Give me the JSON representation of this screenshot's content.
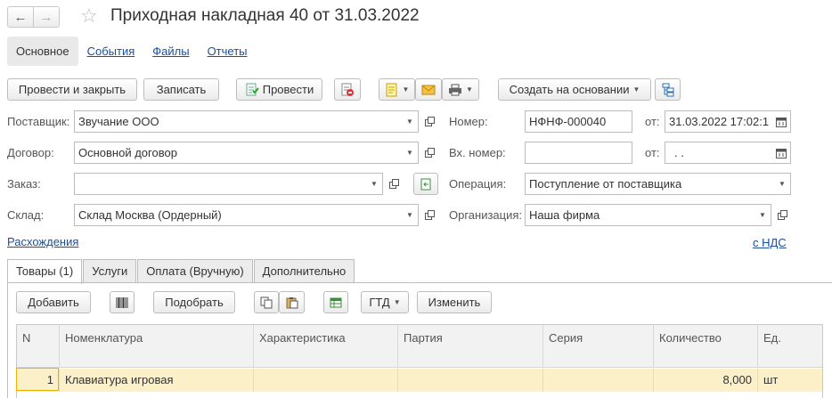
{
  "window": {
    "title": "Приходная накладная 40 от 31.03.2022"
  },
  "sections": [
    "Основное",
    "События",
    "Файлы",
    "Отчеты"
  ],
  "toolbar": {
    "post_close": "Провести и закрыть",
    "save": "Записать",
    "post": "Провести",
    "create_based": "Создать на основании"
  },
  "form": {
    "supplier_label": "Поставщик:",
    "supplier_value": "Звучание ООО",
    "contract_label": "Договор:",
    "contract_value": "Основной договор",
    "order_label": "Заказ:",
    "order_value": "",
    "warehouse_label": "Склад:",
    "warehouse_value": "Склад Москва (Ордерный)",
    "number_label": "Номер:",
    "number_value": "НФНФ-000040",
    "date_label": "от:",
    "date_value": "31.03.2022 17:02:1",
    "in_number_label": "Вх. номер:",
    "in_number_value": "",
    "in_date_label": "от:",
    "in_date_value": "  .  .",
    "operation_label": "Операция:",
    "operation_value": "Поступление от поставщика",
    "organization_label": "Организация:",
    "organization_value": "Наша фирма"
  },
  "links": {
    "discrepancies": "Расхождения",
    "vat": "с НДС"
  },
  "tabs": [
    "Товары (1)",
    "Услуги",
    "Оплата (Вручную)",
    "Дополнительно"
  ],
  "goods_toolbar": {
    "add": "Добавить",
    "pick": "Подобрать",
    "gtd": "ГТД",
    "change": "Изменить"
  },
  "table": {
    "columns": [
      "N",
      "Номенклатура",
      "Характеристика",
      "Партия",
      "Серия",
      "Количество",
      "Ед."
    ],
    "rows": [
      {
        "n": "1",
        "item": "Клавиатура игровая",
        "char": "",
        "batch": "",
        "series": "",
        "qty": "8,000",
        "unit": "шт"
      }
    ]
  },
  "colors": {
    "link": "#1a4fa0",
    "row_selected": "#fbf0c8",
    "accent_red": "#d33"
  }
}
